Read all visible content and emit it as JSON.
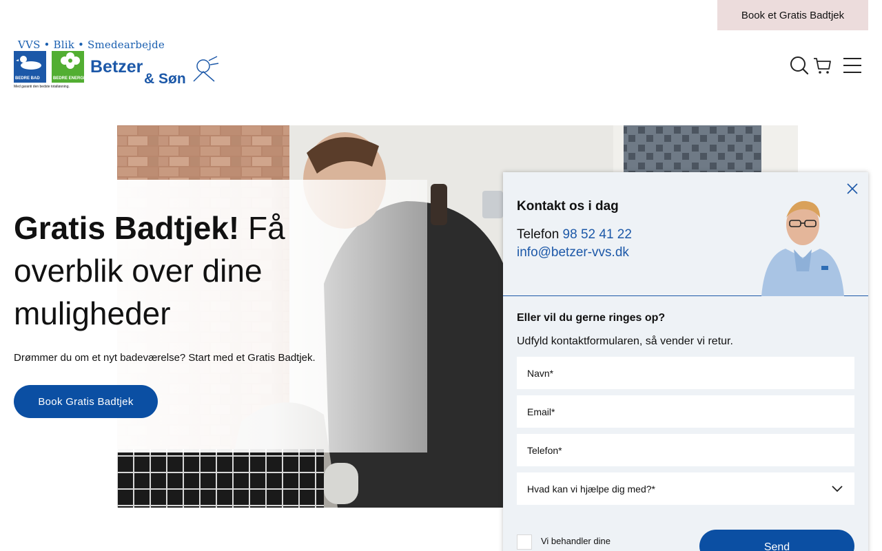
{
  "header": {
    "cta_label": "Book et Gratis Badtjek",
    "logo": {
      "tagline": "VVS • Blik • Smedearbejde",
      "badge_left": "BEDRE BAD",
      "badge_right": "BEDRE ENERGI",
      "sub": "Med garanti den bedste totalløsning.",
      "name": "Betzer",
      "name_suffix": "& Søn"
    },
    "icons": [
      "search-icon",
      "cart-icon",
      "menu-icon"
    ]
  },
  "hero": {
    "title_bold": "Gratis Badtjek!",
    "title_rest": " Få overblik over dine muligheder",
    "subtitle": "Drømmer du om et nyt badeværelse? Start med et Gratis Badtjek.",
    "button_label": "Book Gratis Badtjek"
  },
  "contact_panel": {
    "heading": "Kontakt os i dag",
    "phone_label": "Telefon ",
    "phone_number": "98 52 41 22",
    "email": "info@betzer-vvs.dk",
    "form_heading": "Eller vil du gerne ringes op?",
    "form_subtitle": "Udfyld kontaktformularen, så vender vi retur.",
    "fields": {
      "name_placeholder": "Navn*",
      "email_placeholder": "Email*",
      "phone_placeholder": "Telefon*",
      "help_select": "Hvad kan vi hjælpe dig med?*"
    },
    "consent_text": "Vi behandler dine",
    "send_label": "Send"
  },
  "colors": {
    "brand_blue": "#0b4fa3",
    "logo_blue": "#1c58a8",
    "logo_green": "#52ae32",
    "cta_pink": "#ecdcdc",
    "panel_bg": "#eef2f6"
  }
}
